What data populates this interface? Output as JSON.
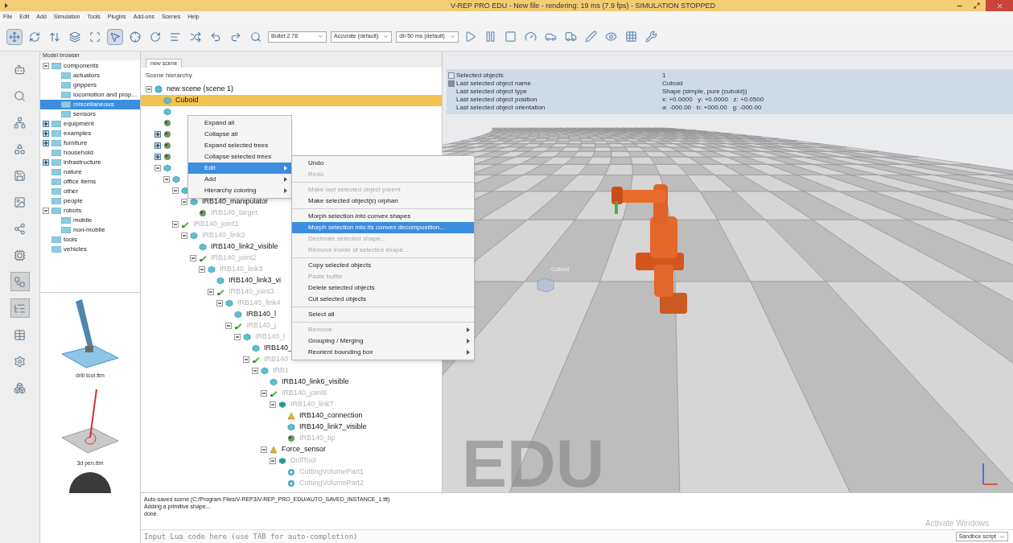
{
  "window": {
    "title": "V-REP PRO EDU - New file - rendering: 19 ms (7.9 fps) - SIMULATION STOPPED"
  },
  "menu": [
    "File",
    "Edit",
    "Add",
    "Simulation",
    "Tools",
    "Plugins",
    "Add-ons",
    "Scenes",
    "Help"
  ],
  "toolbar": {
    "tools": [
      {
        "selected": true
      },
      {
        "selected": false
      },
      {
        "selected": false
      },
      {
        "selected": false
      },
      {
        "selected": false
      },
      {
        "selected": true
      },
      {
        "selected": false
      },
      {
        "selected": false
      },
      {
        "selected": false
      },
      {
        "selected": false
      },
      {
        "selected": false
      },
      {
        "selected": false
      },
      {
        "selected": false
      }
    ],
    "dropdowns": [
      {
        "value": "Bullet 2.78"
      },
      {
        "value": "Accurate (default)"
      },
      {
        "value": "dt=50 ms (default)"
      }
    ]
  },
  "side_buttons": [
    {
      "selected": false
    },
    {
      "selected": false
    },
    {
      "selected": false
    },
    {
      "selected": false
    },
    {
      "selected": false
    },
    {
      "selected": false
    },
    {
      "selected": false
    },
    {
      "selected": false
    },
    {
      "selected": true
    },
    {
      "selected": true
    },
    {
      "selected": false
    },
    {
      "selected": false
    },
    {
      "selected": false
    }
  ],
  "model_browser": {
    "title": "Model browser",
    "tree": [
      {
        "label": "components",
        "selected": false,
        "expanded": true,
        "children": [
          {
            "label": "actuators",
            "selected": false
          },
          {
            "label": "grippers",
            "selected": false
          },
          {
            "label": "locomotion and prop...",
            "selected": false
          },
          {
            "label": "miscellaneous",
            "selected": true
          },
          {
            "label": "sensors",
            "selected": false
          }
        ]
      },
      {
        "label": "equipment",
        "selected": false,
        "expanded": false
      },
      {
        "label": "examples",
        "selected": false,
        "expanded": false
      },
      {
        "label": "furniture",
        "selected": false,
        "expanded": false
      },
      {
        "label": "household",
        "selected": false
      },
      {
        "label": "infrastructure",
        "selected": false,
        "expanded": false
      },
      {
        "label": "nature",
        "selected": false
      },
      {
        "label": "office items",
        "selected": false
      },
      {
        "label": "other",
        "selected": false
      },
      {
        "label": "people",
        "selected": false
      },
      {
        "label": "robots",
        "selected": false,
        "expanded": true,
        "children": [
          {
            "label": "mobile",
            "selected": false
          },
          {
            "label": "non-mobile",
            "selected": false
          }
        ]
      },
      {
        "label": "tools",
        "selected": false
      },
      {
        "label": "vehicles",
        "selected": false
      }
    ],
    "thumbnails": [
      {
        "kind": "drill",
        "label": "drill tool.ttm"
      },
      {
        "kind": "pen",
        "label": "3d pen.ttm"
      },
      {
        "kind": "sphere"
      }
    ]
  },
  "scene": {
    "tab": "new scene",
    "title": "Scene hierarchy",
    "tree": [
      {
        "kind": "scene",
        "label": "new scene (scene 1)",
        "selected": false,
        "greyed": false,
        "children": [
          {
            "kind": "shape",
            "label": "Cuboid",
            "selected": true,
            "greyed": false
          },
          {
            "kind": "shape",
            "selected": false
          },
          {
            "kind": "dummy",
            "selected": false
          },
          {
            "kind": "dummy",
            "selected": false,
            "collapsed": true
          },
          {
            "kind": "dummy",
            "selected": false,
            "collapsed": true
          },
          {
            "kind": "dummy",
            "selected": false,
            "collapsed": true
          },
          {
            "kind": "shape",
            "selected": false,
            "children": [
              {
                "kind": "shape",
                "selected": false,
                "children": [
                  {
                    "kind": "shape",
                    "selected": false,
                    "children": [
                      {
                        "kind": "shape",
                        "label": "IRB140_manipulator",
                        "selected": false,
                        "greyed": false,
                        "children": [
                          {
                            "kind": "dummy",
                            "label": "IRB140_target",
                            "selected": false,
                            "greyed": true
                          }
                        ]
                      }
                    ]
                  },
                  {
                    "kind": "joint",
                    "label": "IRB140_joint1",
                    "selected": false,
                    "greyed": true,
                    "children": [
                      {
                        "kind": "shape",
                        "label": "IRB140_link2",
                        "selected": false,
                        "greyed": true,
                        "children": [
                          {
                            "kind": "shape",
                            "label": "IRB140_link2_visible",
                            "selected": false,
                            "greyed": false
                          },
                          {
                            "kind": "joint",
                            "label": "IRB140_joint2",
                            "selected": false,
                            "greyed": true,
                            "children": [
                              {
                                "kind": "shape",
                                "label": "IRB140_link3",
                                "selected": false,
                                "greyed": true,
                                "children": [
                                  {
                                    "kind": "shape",
                                    "label": "IRB140_link3_vi",
                                    "selected": false,
                                    "greyed": false
                                  },
                                  {
                                    "kind": "joint",
                                    "label": "IRB140_joint3",
                                    "selected": false,
                                    "greyed": true,
                                    "children": [
                                      {
                                        "kind": "shape",
                                        "label": "IRB140_link4",
                                        "selected": false,
                                        "greyed": true,
                                        "children": [
                                          {
                                            "kind": "shape",
                                            "label": "IRB140_l",
                                            "selected": false,
                                            "greyed": false
                                          },
                                          {
                                            "kind": "joint",
                                            "label": "IRB140_j",
                                            "selected": false,
                                            "greyed": true,
                                            "children": [
                                              {
                                                "kind": "shape",
                                                "label": "IRB140_l",
                                                "selected": false,
                                                "greyed": true,
                                                "children": [
                                                  {
                                                    "kind": "shape",
                                                    "label": "IRB140_",
                                                    "selected": false,
                                                    "greyed": false
                                                  },
                                                  {
                                                    "kind": "joint",
                                                    "label": "IRB140",
                                                    "selected": false,
                                                    "greyed": true,
                                                    "children": [
                                                      {
                                                        "kind": "shape",
                                                        "label": "IRB1",
                                                        "selected": false,
                                                        "greyed": true,
                                                        "children": [
                                                          {
                                                            "kind": "shape",
                                                            "label": "IRB140_link6_visible",
                                                            "selected": false,
                                                            "greyed": false
                                                          },
                                                          {
                                                            "kind": "joint",
                                                            "label": "IRB140_joint6",
                                                            "selected": false,
                                                            "greyed": true,
                                                            "children": [
                                                              {
                                                                "kind": "cube",
                                                                "label": "IRB140_link7",
                                                                "selected": false,
                                                                "greyed": true,
                                                                "children": [
                                                                  {
                                                                    "kind": "sensor",
                                                                    "label": "IRB140_connection",
                                                                    "selected": false,
                                                                    "greyed": false
                                                                  },
                                                                  {
                                                                    "kind": "shape",
                                                                    "label": "IRB140_link7_visible",
                                                                    "selected": false,
                                                                    "greyed": false
                                                                  },
                                                                  {
                                                                    "kind": "dummy",
                                                                    "label": "IRB140_tip",
                                                                    "selected": false,
                                                                    "greyed": true
                                                                  }
                                                                ]
                                                              }
                                                            ]
                                                          },
                                                          {
                                                            "kind": "sensor",
                                                            "label": "Force_sensor",
                                                            "selected": false,
                                                            "greyed": false,
                                                            "children": [
                                                              {
                                                                "kind": "cube",
                                                                "label": "DrillTool",
                                                                "selected": false,
                                                                "greyed": true,
                                                                "children": [
                                                                  {
                                                                    "kind": "mill",
                                                                    "label": "CuttingVolumePart1",
                                                                    "selected": false,
                                                                    "greyed": true
                                                                  },
                                                                  {
                                                                    "kind": "mill",
                                                                    "label": "CuttingVolumePart2",
                                                                    "selected": false,
                                                                    "greyed": true
                                                                  }
                                                                ]
                                                              }
                                                            ]
                                                          }
                                                        ]
                                                      }
                                                    ]
                                                  }
                                                ]
                                              }
                                            ]
                                          }
                                        ]
                                      }
                                    ]
                                  }
                                ]
                              }
                            ]
                          }
                        ]
                      }
                    ]
                  }
                ]
              }
            ]
          }
        ]
      }
    ]
  },
  "context_menu": [
    {
      "kind": "item",
      "label": "Expand all",
      "selected": false,
      "disabled": false,
      "submenu": false
    },
    {
      "kind": "item",
      "label": "Collapse all",
      "selected": false,
      "disabled": false,
      "submenu": false
    },
    {
      "kind": "item",
      "label": "Expand selected trees",
      "selected": false,
      "disabled": false,
      "submenu": false
    },
    {
      "kind": "item",
      "label": "Collapse selected trees",
      "selected": false,
      "disabled": false,
      "submenu": false
    },
    {
      "kind": "item",
      "label": "Edit",
      "selected": true,
      "disabled": false,
      "submenu": true
    },
    {
      "kind": "item",
      "label": "Add",
      "selected": false,
      "disabled": false,
      "submenu": true
    },
    {
      "kind": "item",
      "label": "Hierarchy coloring",
      "selected": false,
      "disabled": false,
      "submenu": true
    }
  ],
  "edit_submenu": [
    {
      "kind": "item",
      "label": "Undo",
      "selected": false,
      "disabled": false,
      "submenu": false
    },
    {
      "kind": "item",
      "label": "Redo",
      "selected": false,
      "disabled": true,
      "submenu": false
    },
    {
      "kind": "separator"
    },
    {
      "kind": "item",
      "label": "Make last selected object parent",
      "selected": false,
      "disabled": true,
      "submenu": false
    },
    {
      "kind": "item",
      "label": "Make selected object(s) orphan",
      "selected": false,
      "disabled": false,
      "submenu": false
    },
    {
      "kind": "separator"
    },
    {
      "kind": "item",
      "label": "Morph selection into convex shapes",
      "selected": false,
      "disabled": false,
      "submenu": false
    },
    {
      "kind": "item",
      "label": "Morph selection into its convex decomposition...",
      "selected": true,
      "disabled": false,
      "submenu": false
    },
    {
      "kind": "item",
      "label": "Decimate selected shape...",
      "selected": false,
      "disabled": true,
      "submenu": false
    },
    {
      "kind": "item",
      "label": "Remove inside of selected shape...",
      "selected": false,
      "disabled": true,
      "submenu": false
    },
    {
      "kind": "separator"
    },
    {
      "kind": "item",
      "label": "Copy selected objects",
      "selected": false,
      "disabled": false,
      "submenu": false
    },
    {
      "kind": "item",
      "label": "Paste buffer",
      "selected": false,
      "disabled": true,
      "submenu": false
    },
    {
      "kind": "item",
      "label": "Delete selected objects",
      "selected": false,
      "disabled": false,
      "submenu": false
    },
    {
      "kind": "item",
      "label": "Cut selected objects",
      "selected": false,
      "disabled": false,
      "submenu": false
    },
    {
      "kind": "separator"
    },
    {
      "kind": "item",
      "label": "Select all",
      "selected": false,
      "disabled": false,
      "submenu": false
    },
    {
      "kind": "separator"
    },
    {
      "kind": "item",
      "label": "Remove",
      "selected": false,
      "disabled": true,
      "submenu": true
    },
    {
      "kind": "item",
      "label": "Grouping / Merging",
      "selected": false,
      "disabled": false,
      "submenu": true
    },
    {
      "kind": "item",
      "label": "Reorient bounding box",
      "selected": false,
      "disabled": false,
      "submenu": true
    }
  ],
  "info": [
    {
      "label": "Selected objects",
      "value": "1",
      "expanded": false
    },
    {
      "label": "Last selected object name",
      "value": "Cuboid",
      "expanded": true
    },
    {
      "label": "Last selected object type",
      "value": "Shape (simple, pure (cuboid))"
    },
    {
      "label": "Last selected object position",
      "value": "x: +0.0000   y: +0.0000   z: +0.0500"
    },
    {
      "label": "Last selected object orientation",
      "value": "a: -000.00   b: +000.00   g: -000.00"
    }
  ],
  "viewport": {
    "object_label": "Cuboid",
    "watermark": "EDU"
  },
  "console": {
    "lines": [
      "Auto-saved scene (C:/Program Files/V-REP3/V-REP_PRO_EDU/AUTO_SAVED_INSTANCE_1.ttt)",
      "Adding a primitive shape...",
      "done."
    ],
    "os_notice": "Activate Windows",
    "placeholder": "Input Lua code here (use TAB for auto-completion)",
    "script": "Sandbox script"
  }
}
